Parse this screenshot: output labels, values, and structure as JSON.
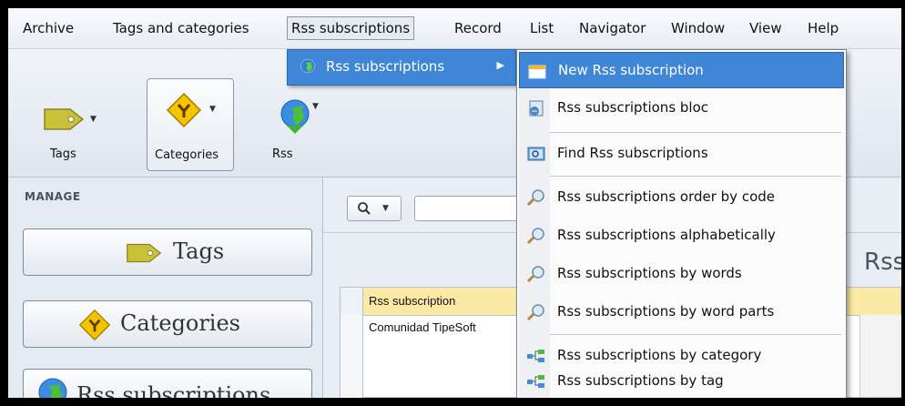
{
  "menubar": {
    "items": [
      "Archive",
      "Tags and categories",
      "Rss subscriptions",
      "Record",
      "List",
      "Navigator",
      "Window",
      "View",
      "Help"
    ]
  },
  "ribbon": {
    "buttons": [
      {
        "label": "Tags",
        "icon": "tag-icon"
      },
      {
        "label": "Categories",
        "icon": "category-icon"
      },
      {
        "label": "Rss",
        "icon": "globe-icon"
      }
    ]
  },
  "sidebar": {
    "title": "MANAGE",
    "items": [
      {
        "label": "Tags",
        "icon": "tag-icon"
      },
      {
        "label": "Categories",
        "icon": "category-icon"
      },
      {
        "label": "Rss subscriptions",
        "icon": "globe-icon"
      }
    ]
  },
  "main": {
    "heading_partial": "Rss",
    "grid": {
      "columns": [
        "Rss subscription"
      ],
      "rows": [
        [
          "Comunidad TipeSoft"
        ]
      ]
    }
  },
  "submenu1": {
    "label": "Rss subscriptions",
    "icon": "globe-icon"
  },
  "submenu2": {
    "items": [
      {
        "label": "New Rss subscription",
        "icon": "new-item-icon",
        "highlighted": true
      },
      {
        "label": "Rss subscriptions bloc",
        "icon": "bloc-icon"
      },
      {
        "label": "Find Rss subscriptions",
        "icon": "find-icon"
      },
      {
        "label": "Rss subscriptions order by code",
        "icon": "magnifier-icon"
      },
      {
        "label": "Rss subscriptions alphabetically",
        "icon": "magnifier-icon"
      },
      {
        "label": "Rss subscriptions by words",
        "icon": "magnifier-icon"
      },
      {
        "label": "Rss subscriptions by word parts",
        "icon": "magnifier-icon"
      },
      {
        "label": "Rss subscriptions by category",
        "icon": "tree-icon"
      },
      {
        "label": "Rss subscriptions by tag",
        "icon": "tree-icon"
      }
    ]
  },
  "colors": {
    "highlight": "#3f86d6",
    "grid_header": "#fbeaa6"
  }
}
